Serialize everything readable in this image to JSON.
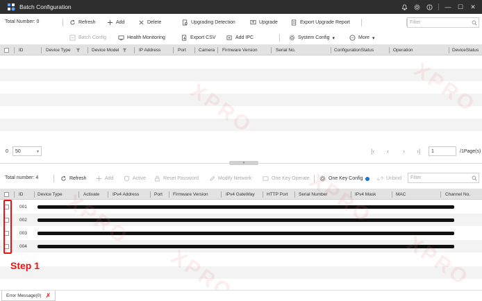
{
  "window": {
    "title": "Batch Configuration",
    "controls": {
      "bell": "bell-icon",
      "settings": "gear-icon",
      "info": "info-icon",
      "minimize": "—",
      "maximize": "☐",
      "close": "✕"
    }
  },
  "top": {
    "total_label": "Total Number: 0",
    "toolbar_row1": [
      "Refresh",
      "Add",
      "Delete",
      "Upgrading Detection",
      "Upgrade",
      "Export Upgrade Report"
    ],
    "toolbar_row2": [
      "Batch Config",
      "Health Monitoring",
      "Export CSV",
      "Add IPC",
      "System Config",
      "More"
    ],
    "filter_placeholder": "Filter",
    "columns": [
      "ID",
      "Device Type",
      "Device Model",
      "IP Address",
      "Port",
      "Camera",
      "Firmware Version",
      "Serial No.",
      "ConfigurationStatus",
      "Operation",
      "DeviceStatus"
    ]
  },
  "pager": {
    "count": "0",
    "page_size": "50",
    "page_input": "1",
    "page_total": "/1Page(s)"
  },
  "bottom": {
    "total_label": "Total number: 4",
    "toolbar": [
      "Refresh",
      "Add",
      "Active",
      "Reset Password",
      "Modify Network",
      "One Key Operate",
      "One Key Config",
      "Unbind"
    ],
    "filter_placeholder": "Filter",
    "columns": [
      "ID",
      "Device Type",
      "Activate",
      "IPv4 Address",
      "Port",
      "Firmware Version",
      "IPv4 GateWay",
      "HTTP Port",
      "Serial Number",
      "IPv4 Mask",
      "MAC",
      "Channel No."
    ],
    "rows": [
      {
        "id": "001"
      },
      {
        "id": "002"
      },
      {
        "id": "003"
      },
      {
        "id": "004"
      }
    ]
  },
  "annotation": {
    "step_label": "Step 1",
    "color": "#e11111"
  },
  "status": {
    "error_tab": "Error Message(0)"
  },
  "watermark": "XPRO"
}
